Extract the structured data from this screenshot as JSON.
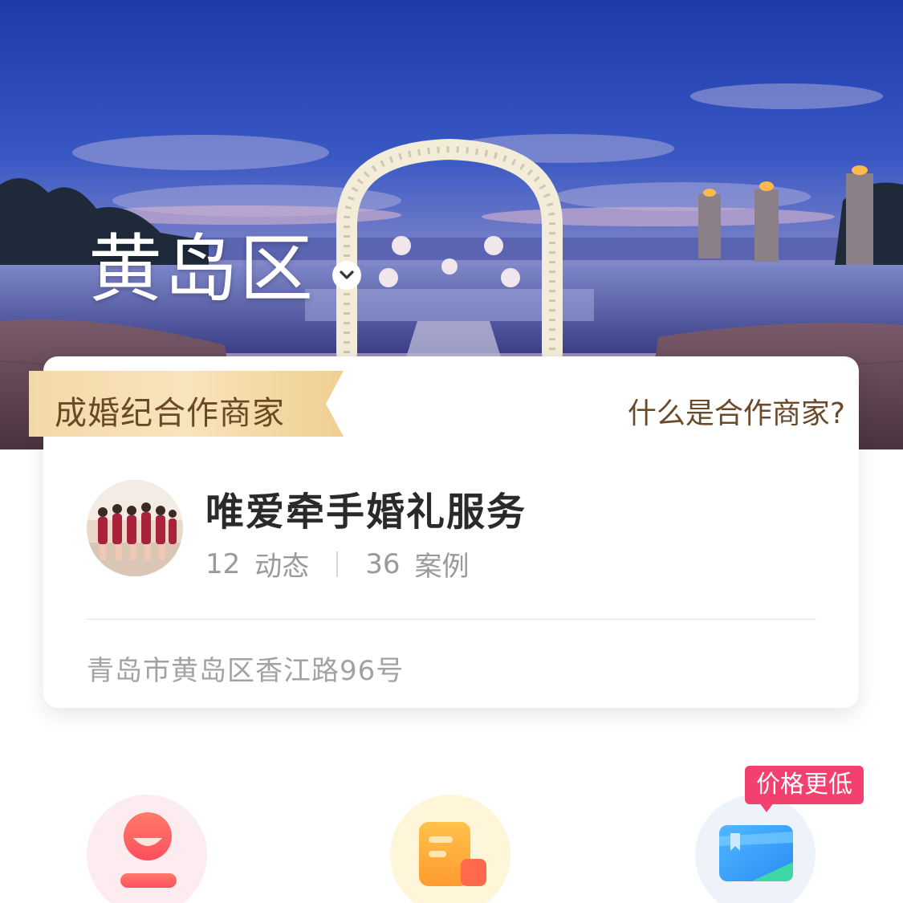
{
  "hero": {
    "district": "黄岛区",
    "district_icon": "chevron-down-icon"
  },
  "card": {
    "partner_label": "成婚纪合作商家",
    "what_link": "什么是合作商家?",
    "merchant": {
      "name": "唯爱牵手婚礼服务",
      "stats": [
        {
          "value": "12",
          "label": "动态"
        },
        {
          "value": "36",
          "label": "案例"
        }
      ],
      "address": "青岛市黄岛区香江路96号"
    }
  },
  "features": {
    "items": [
      {
        "icon": "person-icon"
      },
      {
        "icon": "document-icon"
      },
      {
        "icon": "coupon-icon",
        "badge": "价格更低"
      }
    ]
  },
  "colors": {
    "ribbon_gold": "#f1d29b",
    "brown_text": "#6a4a24",
    "badge_pink": "#f2416f"
  }
}
